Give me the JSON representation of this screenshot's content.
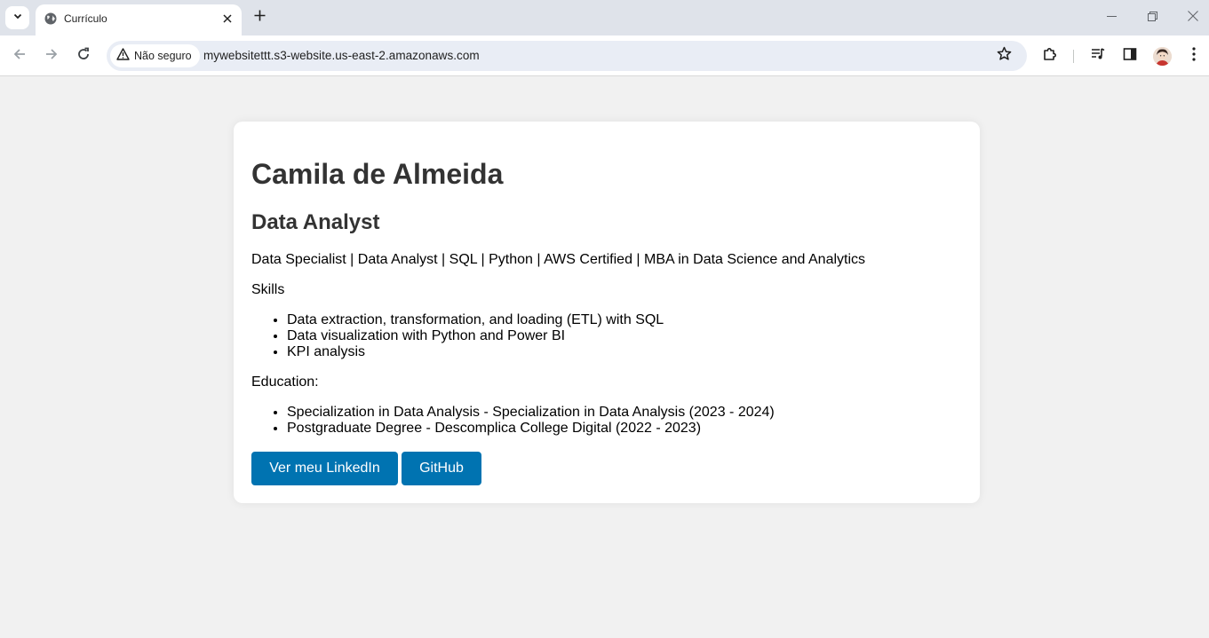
{
  "browser": {
    "tab": {
      "title": "Currículo"
    },
    "address_bar": {
      "security_label": "Não seguro",
      "url": "mywebsitettt.s3-website.us-east-2.amazonaws.com"
    }
  },
  "page": {
    "name": "Camila de Almeida",
    "role": "Data Analyst",
    "tagline": "Data Specialist | Data Analyst | SQL | Python | AWS Certified | MBA in Data Science and Analytics",
    "skills": {
      "title": "Skills",
      "items": [
        "Data extraction, transformation, and loading (ETL) with SQL",
        "Data visualization with Python and Power BI",
        "KPI analysis"
      ]
    },
    "education": {
      "title": "Education:",
      "items": [
        "Specialization in Data Analysis - Specialization in Data Analysis (2023 - 2024)",
        "Postgraduate Degree - Descomplica College Digital (2022 - 2023)"
      ]
    },
    "buttons": {
      "linkedin": "Ver meu LinkedIn",
      "github": "GitHub"
    }
  },
  "colors": {
    "button_bg": "#0073b1",
    "page_bg": "#f1f1f1",
    "tabstrip_bg": "#dfe3ea"
  },
  "icons": [
    "tab-search-icon",
    "globe-icon",
    "close-icon",
    "plus-icon",
    "minimize-icon",
    "restore-icon",
    "window-close-icon",
    "back-arrow-icon",
    "forward-arrow-icon",
    "reload-icon",
    "warning-icon",
    "star-icon",
    "puzzle-icon",
    "media-icon",
    "side-panel-icon",
    "profile-avatar-icon",
    "kebab-menu-icon"
  ]
}
